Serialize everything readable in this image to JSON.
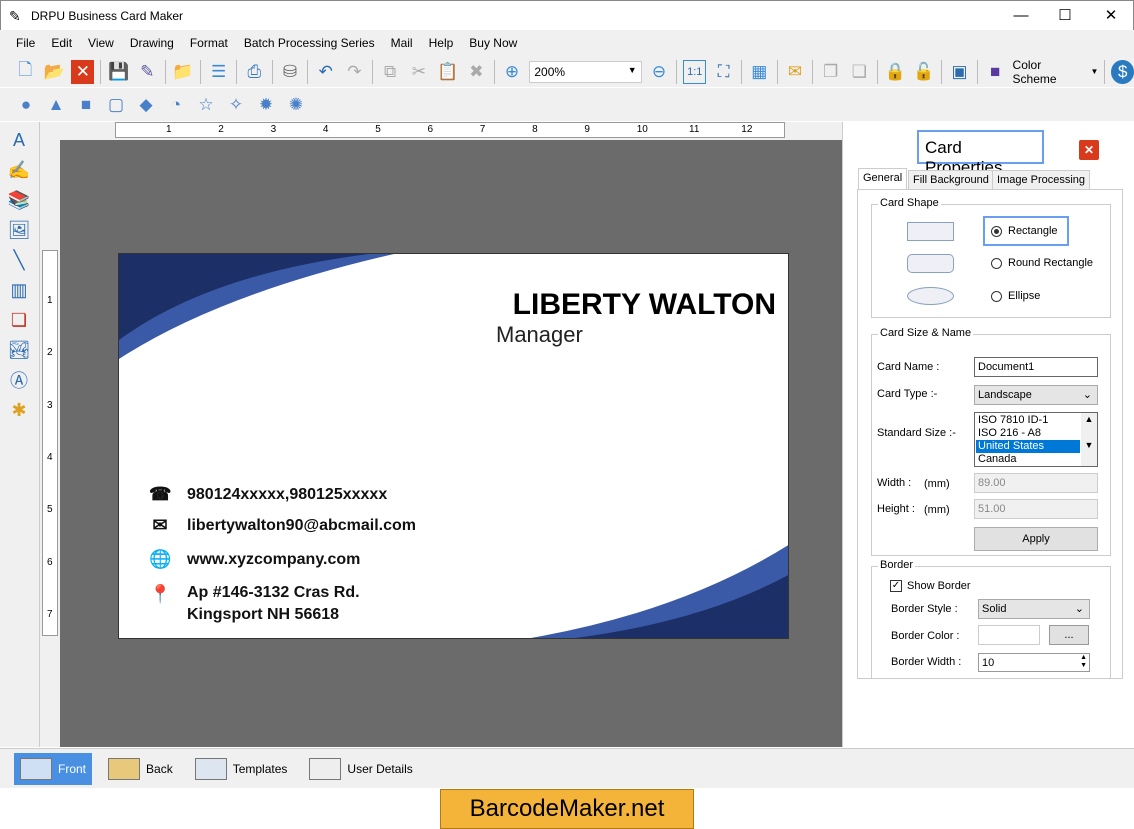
{
  "window": {
    "title": "DRPU Business Card Maker",
    "minimize": "—",
    "maximize": "☐",
    "close": "✕"
  },
  "menu": [
    "File",
    "Edit",
    "View",
    "Drawing",
    "Format",
    "Batch Processing Series",
    "Mail",
    "Help",
    "Buy Now"
  ],
  "toolbar": {
    "zoom": "200%",
    "color_scheme": "Color Scheme"
  },
  "card": {
    "name": "LIBERTY WALTON",
    "role": "Manager",
    "phone": "980124xxxxx,980125xxxxx",
    "email": "libertywalton90@abcmail.com",
    "web": "www.xyzcompany.com",
    "address1": "Ap #146-3132 Cras Rd.",
    "address2": "Kingsport NH 56618",
    "accent": "#2b4a8f",
    "dark": "#1c2f66"
  },
  "ruler": {
    "top": [
      "1",
      "2",
      "3",
      "4",
      "5",
      "6",
      "7",
      "8",
      "9",
      "10",
      "11",
      "12"
    ],
    "left": [
      "1",
      "2",
      "3",
      "4",
      "5",
      "6",
      "7"
    ]
  },
  "panel": {
    "title": "Card Properties",
    "tabs": [
      "General",
      "Fill Background",
      "Image Processing"
    ],
    "shape": {
      "label": "Card Shape",
      "options": [
        "Rectangle",
        "Round Rectangle",
        "Ellipse"
      ],
      "selected": "Rectangle"
    },
    "size": {
      "label": "Card Size & Name",
      "card_name_label": "Card Name :",
      "card_name": "Document1",
      "card_type_label": "Card Type :-",
      "card_type": "Landscape",
      "standard_label": "Standard Size :-",
      "standard_options": [
        "ISO 7810 ID-1",
        "ISO 216 - A8",
        "United States",
        "Canada"
      ],
      "standard_selected": "United States",
      "width_label": "Width :",
      "height_label": "Height :",
      "unit": "(mm)",
      "width": "89.00",
      "height": "51.00",
      "apply": "Apply"
    },
    "border": {
      "label": "Border",
      "show_border": "Show Border",
      "show_checked": true,
      "style_label": "Border Style :",
      "style": "Solid",
      "color_label": "Border Color :",
      "color_btn": "...",
      "width_label": "Border Width :",
      "width": "10"
    }
  },
  "bottom_tabs": [
    "Front",
    "Back",
    "Templates",
    "User Details"
  ],
  "banner": "BarcodeMaker.net"
}
